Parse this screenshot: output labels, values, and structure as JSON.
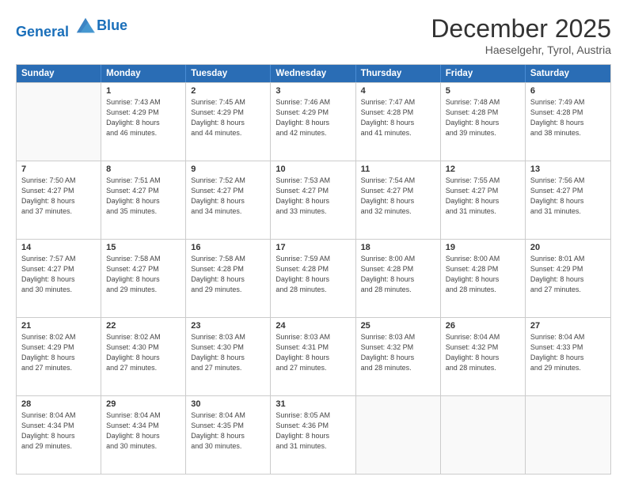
{
  "header": {
    "logo_line1": "General",
    "logo_line2": "Blue",
    "month": "December 2025",
    "location": "Haeselgehr, Tyrol, Austria"
  },
  "days_of_week": [
    "Sunday",
    "Monday",
    "Tuesday",
    "Wednesday",
    "Thursday",
    "Friday",
    "Saturday"
  ],
  "weeks": [
    [
      {
        "day": "",
        "info": ""
      },
      {
        "day": "1",
        "info": "Sunrise: 7:43 AM\nSunset: 4:29 PM\nDaylight: 8 hours\nand 46 minutes."
      },
      {
        "day": "2",
        "info": "Sunrise: 7:45 AM\nSunset: 4:29 PM\nDaylight: 8 hours\nand 44 minutes."
      },
      {
        "day": "3",
        "info": "Sunrise: 7:46 AM\nSunset: 4:29 PM\nDaylight: 8 hours\nand 42 minutes."
      },
      {
        "day": "4",
        "info": "Sunrise: 7:47 AM\nSunset: 4:28 PM\nDaylight: 8 hours\nand 41 minutes."
      },
      {
        "day": "5",
        "info": "Sunrise: 7:48 AM\nSunset: 4:28 PM\nDaylight: 8 hours\nand 39 minutes."
      },
      {
        "day": "6",
        "info": "Sunrise: 7:49 AM\nSunset: 4:28 PM\nDaylight: 8 hours\nand 38 minutes."
      }
    ],
    [
      {
        "day": "7",
        "info": "Sunrise: 7:50 AM\nSunset: 4:27 PM\nDaylight: 8 hours\nand 37 minutes."
      },
      {
        "day": "8",
        "info": "Sunrise: 7:51 AM\nSunset: 4:27 PM\nDaylight: 8 hours\nand 35 minutes."
      },
      {
        "day": "9",
        "info": "Sunrise: 7:52 AM\nSunset: 4:27 PM\nDaylight: 8 hours\nand 34 minutes."
      },
      {
        "day": "10",
        "info": "Sunrise: 7:53 AM\nSunset: 4:27 PM\nDaylight: 8 hours\nand 33 minutes."
      },
      {
        "day": "11",
        "info": "Sunrise: 7:54 AM\nSunset: 4:27 PM\nDaylight: 8 hours\nand 32 minutes."
      },
      {
        "day": "12",
        "info": "Sunrise: 7:55 AM\nSunset: 4:27 PM\nDaylight: 8 hours\nand 31 minutes."
      },
      {
        "day": "13",
        "info": "Sunrise: 7:56 AM\nSunset: 4:27 PM\nDaylight: 8 hours\nand 31 minutes."
      }
    ],
    [
      {
        "day": "14",
        "info": "Sunrise: 7:57 AM\nSunset: 4:27 PM\nDaylight: 8 hours\nand 30 minutes."
      },
      {
        "day": "15",
        "info": "Sunrise: 7:58 AM\nSunset: 4:27 PM\nDaylight: 8 hours\nand 29 minutes."
      },
      {
        "day": "16",
        "info": "Sunrise: 7:58 AM\nSunset: 4:28 PM\nDaylight: 8 hours\nand 29 minutes."
      },
      {
        "day": "17",
        "info": "Sunrise: 7:59 AM\nSunset: 4:28 PM\nDaylight: 8 hours\nand 28 minutes."
      },
      {
        "day": "18",
        "info": "Sunrise: 8:00 AM\nSunset: 4:28 PM\nDaylight: 8 hours\nand 28 minutes."
      },
      {
        "day": "19",
        "info": "Sunrise: 8:00 AM\nSunset: 4:28 PM\nDaylight: 8 hours\nand 28 minutes."
      },
      {
        "day": "20",
        "info": "Sunrise: 8:01 AM\nSunset: 4:29 PM\nDaylight: 8 hours\nand 27 minutes."
      }
    ],
    [
      {
        "day": "21",
        "info": "Sunrise: 8:02 AM\nSunset: 4:29 PM\nDaylight: 8 hours\nand 27 minutes."
      },
      {
        "day": "22",
        "info": "Sunrise: 8:02 AM\nSunset: 4:30 PM\nDaylight: 8 hours\nand 27 minutes."
      },
      {
        "day": "23",
        "info": "Sunrise: 8:03 AM\nSunset: 4:30 PM\nDaylight: 8 hours\nand 27 minutes."
      },
      {
        "day": "24",
        "info": "Sunrise: 8:03 AM\nSunset: 4:31 PM\nDaylight: 8 hours\nand 27 minutes."
      },
      {
        "day": "25",
        "info": "Sunrise: 8:03 AM\nSunset: 4:32 PM\nDaylight: 8 hours\nand 28 minutes."
      },
      {
        "day": "26",
        "info": "Sunrise: 8:04 AM\nSunset: 4:32 PM\nDaylight: 8 hours\nand 28 minutes."
      },
      {
        "day": "27",
        "info": "Sunrise: 8:04 AM\nSunset: 4:33 PM\nDaylight: 8 hours\nand 29 minutes."
      }
    ],
    [
      {
        "day": "28",
        "info": "Sunrise: 8:04 AM\nSunset: 4:34 PM\nDaylight: 8 hours\nand 29 minutes."
      },
      {
        "day": "29",
        "info": "Sunrise: 8:04 AM\nSunset: 4:34 PM\nDaylight: 8 hours\nand 30 minutes."
      },
      {
        "day": "30",
        "info": "Sunrise: 8:04 AM\nSunset: 4:35 PM\nDaylight: 8 hours\nand 30 minutes."
      },
      {
        "day": "31",
        "info": "Sunrise: 8:05 AM\nSunset: 4:36 PM\nDaylight: 8 hours\nand 31 minutes."
      },
      {
        "day": "",
        "info": ""
      },
      {
        "day": "",
        "info": ""
      },
      {
        "day": "",
        "info": ""
      }
    ]
  ]
}
